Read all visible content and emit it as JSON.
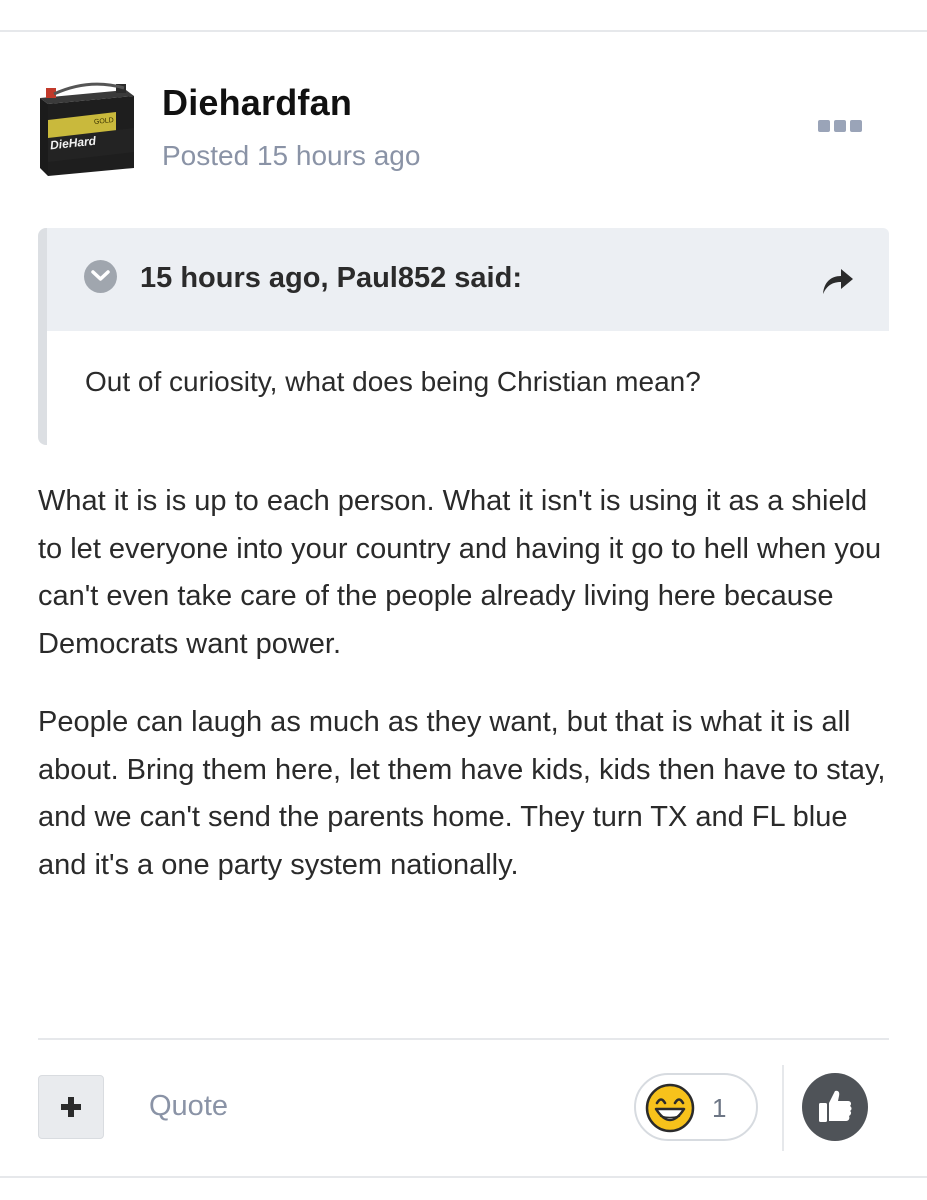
{
  "post": {
    "author": "Diehardfan",
    "posted": "Posted 15 hours ago",
    "avatar": {
      "brand_text": "DieHard",
      "tag_text": "GOLD"
    }
  },
  "quote": {
    "citation": "15 hours ago, Paul852 said:",
    "text": "Out of curiosity, what does being Christian mean?"
  },
  "body": {
    "paragraphs": [
      "What it is is up to each person. What it isn't is using it as a shield to let everyone into your country and having it go to hell when you can't even take care of the people already living here because Democrats want power.",
      "People can laugh as much as they want, but that is what it is all about. Bring them here, let them have kids, kids then have to stay, and we can't send the parents home. They turn TX and FL blue and it's a one party system nationally."
    ]
  },
  "footer": {
    "quote_label": "Quote",
    "reaction_count": "1"
  },
  "icons": {
    "more": "more-options-icon",
    "chevron": "chevron-down-icon",
    "share": "share-icon",
    "plus": "plus-icon",
    "laugh": "laughing-emoji-icon",
    "like": "thumbs-up-icon"
  },
  "colors": {
    "muted_text": "#8a93a6",
    "quote_header_bg": "#eceff3",
    "like_button_bg": "#4f5358"
  }
}
